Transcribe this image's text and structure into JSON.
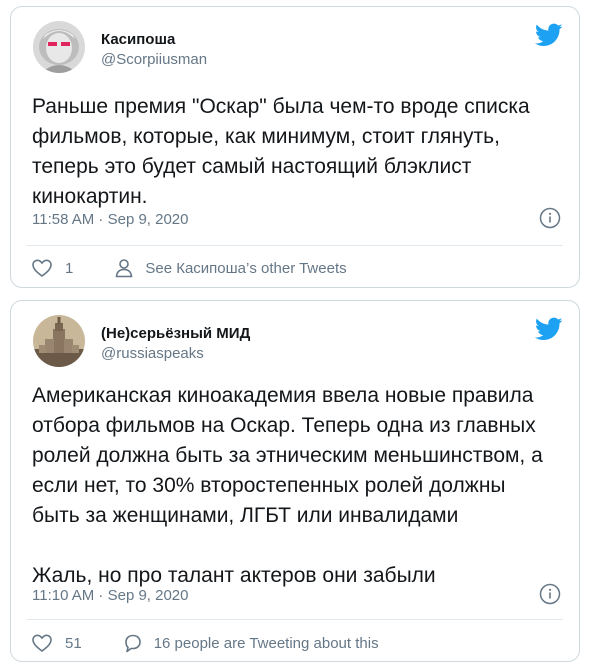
{
  "tweets": [
    {
      "name": "Касипоша",
      "handle": "@Scorpiiusman",
      "text": "Раньше премия \"Оскар\" была чем-то вроде списка\nфильмов, которые, как минимум, стоит глянуть,\nтеперь это будет самый настоящий блэклист\nкинокартин.",
      "timestamp": "11:58 AM · Sep 9, 2020",
      "likes": "1",
      "secondary_label": "See Касипоша’s other Tweets",
      "secondary_icon": "person-icon"
    },
    {
      "name": "(Не)серьёзный МИД",
      "handle": "@russiaspeaks",
      "text": "Американская киноакадемия ввела новые правила\nотбора фильмов на Оскар. Теперь одна из главных\nролей должна быть за этническим меньшинством, а\nесли нет, то 30% второстепенных ролей должны\nбыть за женщинами, ЛГБТ или инвалидами\n\nЖаль, но про талант актеров они забыли",
      "timestamp": "11:10 AM · Sep 9, 2020",
      "likes": "51",
      "secondary_label": "16 people are Tweeting about this",
      "secondary_icon": "speech-bubble-icon"
    }
  ],
  "colors": {
    "twitter_blue": "#1da1f2",
    "text_primary": "#14171a",
    "text_secondary": "#657786",
    "border": "#cfd9de"
  }
}
